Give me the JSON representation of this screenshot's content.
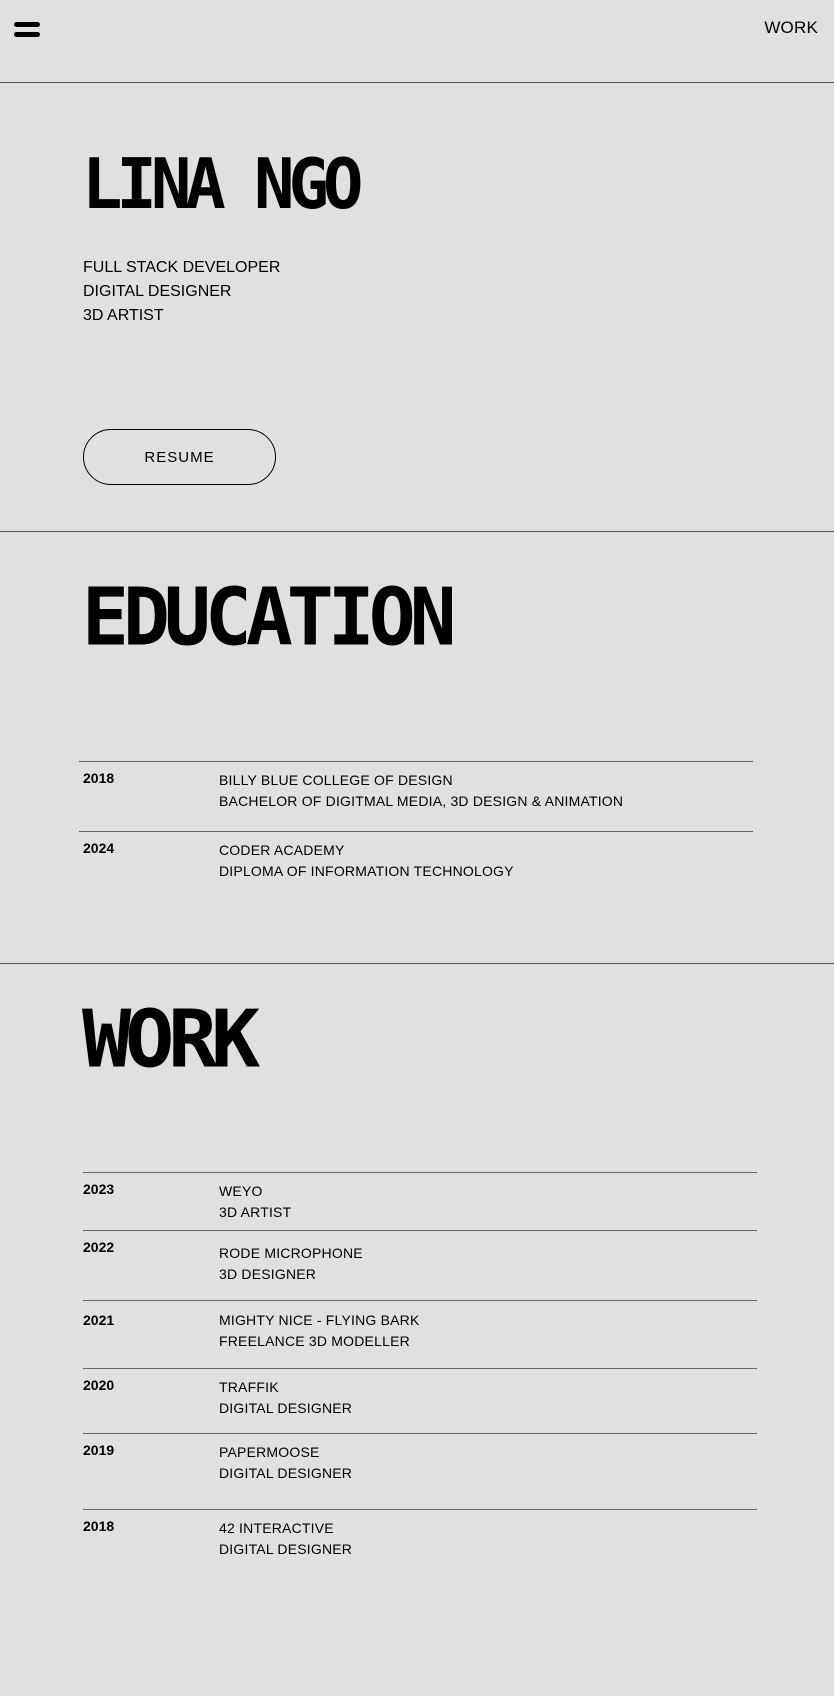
{
  "header": {
    "nav_work": "WORK"
  },
  "hero": {
    "name": "LINA NGO",
    "roles": [
      "FULL STACK DEVELOPER",
      "DIGITAL DESIGNER",
      "3D ARTIST"
    ],
    "resume_label": "RESUME"
  },
  "education": {
    "title": "EDUCATION",
    "items": [
      {
        "year": "2018",
        "school": "BILLY BLUE COLLEGE OF DESIGN",
        "degree": "BACHELOR OF DIGITMAL MEDIA, 3D DESIGN & ANIMATION"
      },
      {
        "year": "2024",
        "school": "CODER ACADEMY",
        "degree": "DIPLOMA OF INFORMATION TECHNOLOGY"
      }
    ]
  },
  "work": {
    "title": "WORK",
    "items": [
      {
        "year": "2023",
        "company": "WEYO",
        "role": "3D ARTIST"
      },
      {
        "year": "2022",
        "company": "RODE MICROPHONE",
        "role": "3D DESIGNER"
      },
      {
        "year": "2021",
        "company": "MIGHTY NICE - FLYING BARK",
        "role": "FREELANCE 3D MODELLER"
      },
      {
        "year": "2020",
        "company": "TRAFFIK",
        "role": "DIGITAL DESIGNER"
      },
      {
        "year": "2019",
        "company": "PAPERMOOSE",
        "role": "DIGITAL DESIGNER"
      },
      {
        "year": "2018",
        "company": "42 INTERACTIVE",
        "role": "DIGITAL DESIGNER"
      }
    ]
  }
}
